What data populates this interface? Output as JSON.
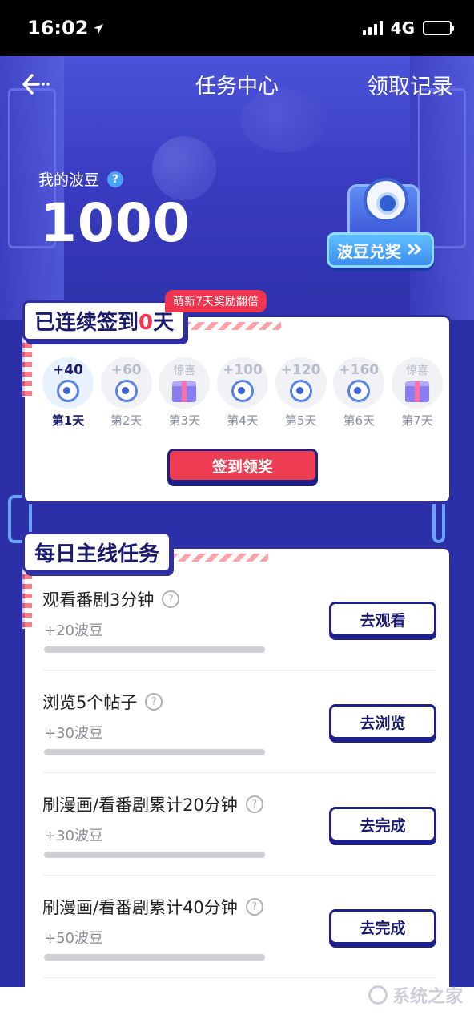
{
  "status_bar": {
    "time": "16:02",
    "network": "4G"
  },
  "nav": {
    "title": "任务中心",
    "right_link": "领取记录"
  },
  "points": {
    "label": "我的波豆",
    "value": "1000",
    "help_icon": "question-icon"
  },
  "redeem": {
    "label": "波豆兑奖"
  },
  "checkin": {
    "badge": "萌新7天奖励翻倍",
    "title_prefix": "已连续签到",
    "streak": "0",
    "title_suffix": "天",
    "days": [
      {
        "reward": "+40",
        "label": "第1天",
        "type": "bean",
        "active": true
      },
      {
        "reward": "+60",
        "label": "第2天",
        "type": "bean",
        "active": false
      },
      {
        "reward": "惊喜",
        "label": "第3天",
        "type": "gift",
        "active": false
      },
      {
        "reward": "+100",
        "label": "第4天",
        "type": "bean",
        "active": false
      },
      {
        "reward": "+120",
        "label": "第5天",
        "type": "bean",
        "active": false
      },
      {
        "reward": "+160",
        "label": "第6天",
        "type": "bean",
        "active": false
      },
      {
        "reward": "惊喜",
        "label": "第7天",
        "type": "gift",
        "active": false
      }
    ],
    "button": "签到领奖"
  },
  "daily_tasks": {
    "title": "每日主线任务",
    "items": [
      {
        "title": "观看番剧3分钟",
        "reward": "+20波豆",
        "button": "去观看",
        "progress": 0
      },
      {
        "title": "浏览5个帖子",
        "reward": "+30波豆",
        "button": "去浏览",
        "progress": 0
      },
      {
        "title": "刷漫画/看番剧累计20分钟",
        "reward": "+30波豆",
        "button": "去完成",
        "progress": 0
      },
      {
        "title": "刷漫画/看番剧累计40分钟",
        "reward": "+50波豆",
        "button": "去完成",
        "progress": 0
      }
    ]
  },
  "watermark": "系统之家",
  "colors": {
    "primary": "#2f2fa3",
    "accent_red": "#ee3d52",
    "hero": "#3a3dc2",
    "redeem_blue": "#3d8df0"
  }
}
